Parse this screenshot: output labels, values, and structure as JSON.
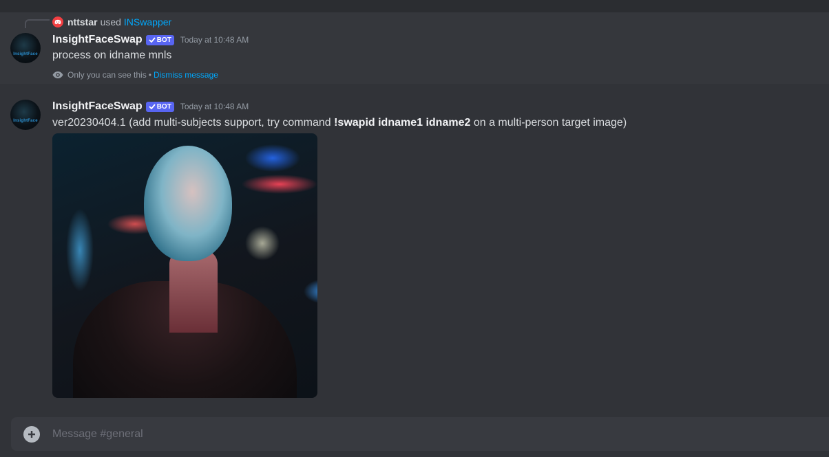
{
  "reply": {
    "user": "nttstar",
    "used": "used",
    "command": "INSwapper"
  },
  "messages": [
    {
      "author": "InsightFaceSwap",
      "bot_tag": "BOT",
      "timestamp": "Today at 10:48 AM",
      "avatar_text": "InsightFace",
      "text": "process on idname mnls",
      "ephemeral_note": "Only you can see this",
      "separator": "•",
      "dismiss": "Dismiss message"
    },
    {
      "author": "InsightFaceSwap",
      "bot_tag": "BOT",
      "timestamp": "Today at 10:48 AM",
      "avatar_text": "InsightFace",
      "text_pre": "ver20230404.1 (add multi-subjects support, try command ",
      "text_bold": "!swapid idname1 idname2",
      "text_post": " on a multi-person target image)"
    }
  ],
  "composer": {
    "placeholder": "Message #general"
  },
  "colors": {
    "background": "#313338",
    "ephemeral_bg": "#35373c",
    "bot_tag": "#5865f2",
    "link": "#00a8fc",
    "discord_red": "#f23f42"
  },
  "icons": [
    "discord-icon",
    "checkmark-icon",
    "eye-icon",
    "plus-circle-icon"
  ]
}
